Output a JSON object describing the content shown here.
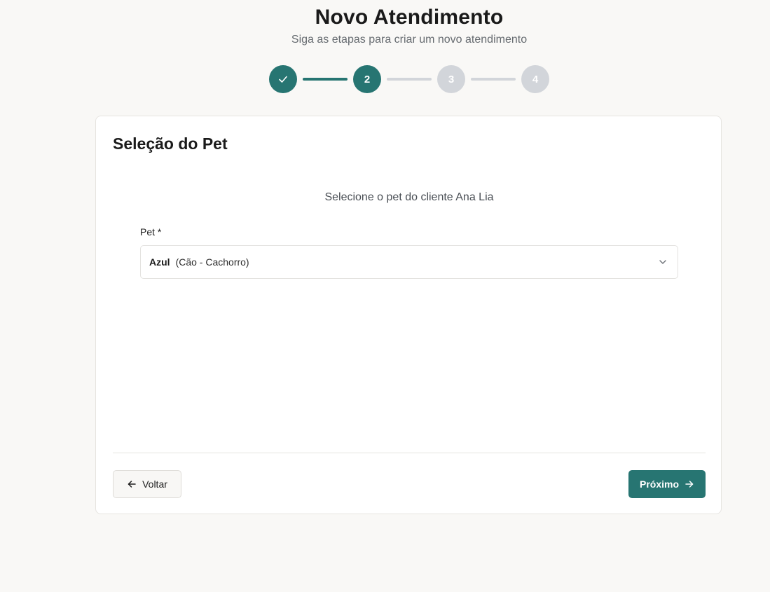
{
  "header": {
    "title": "Novo Atendimento",
    "subtitle": "Siga as etapas para criar um novo atendimento"
  },
  "stepper": {
    "steps": [
      {
        "label": "",
        "state": "done",
        "icon": "check-icon"
      },
      {
        "label": "2",
        "state": "current"
      },
      {
        "label": "3",
        "state": "todo"
      },
      {
        "label": "4",
        "state": "todo"
      }
    ],
    "current_step": 2,
    "total_steps": 4
  },
  "card": {
    "title": "Seleção do Pet",
    "instruction": "Selecione o pet do cliente Ana Lia",
    "pet_field": {
      "label": "Pet *",
      "selected_name": "Azul",
      "selected_detail": "(Cão - Cachorro)",
      "icon": "chevron-down-icon"
    },
    "back_button": {
      "label": "Voltar",
      "icon": "arrow-left-icon"
    },
    "next_button": {
      "label": "Próximo",
      "icon": "arrow-right-icon"
    }
  },
  "colors": {
    "primary": "#277572",
    "inactive_step": "#d2d5da",
    "background": "#f9f8f6"
  }
}
